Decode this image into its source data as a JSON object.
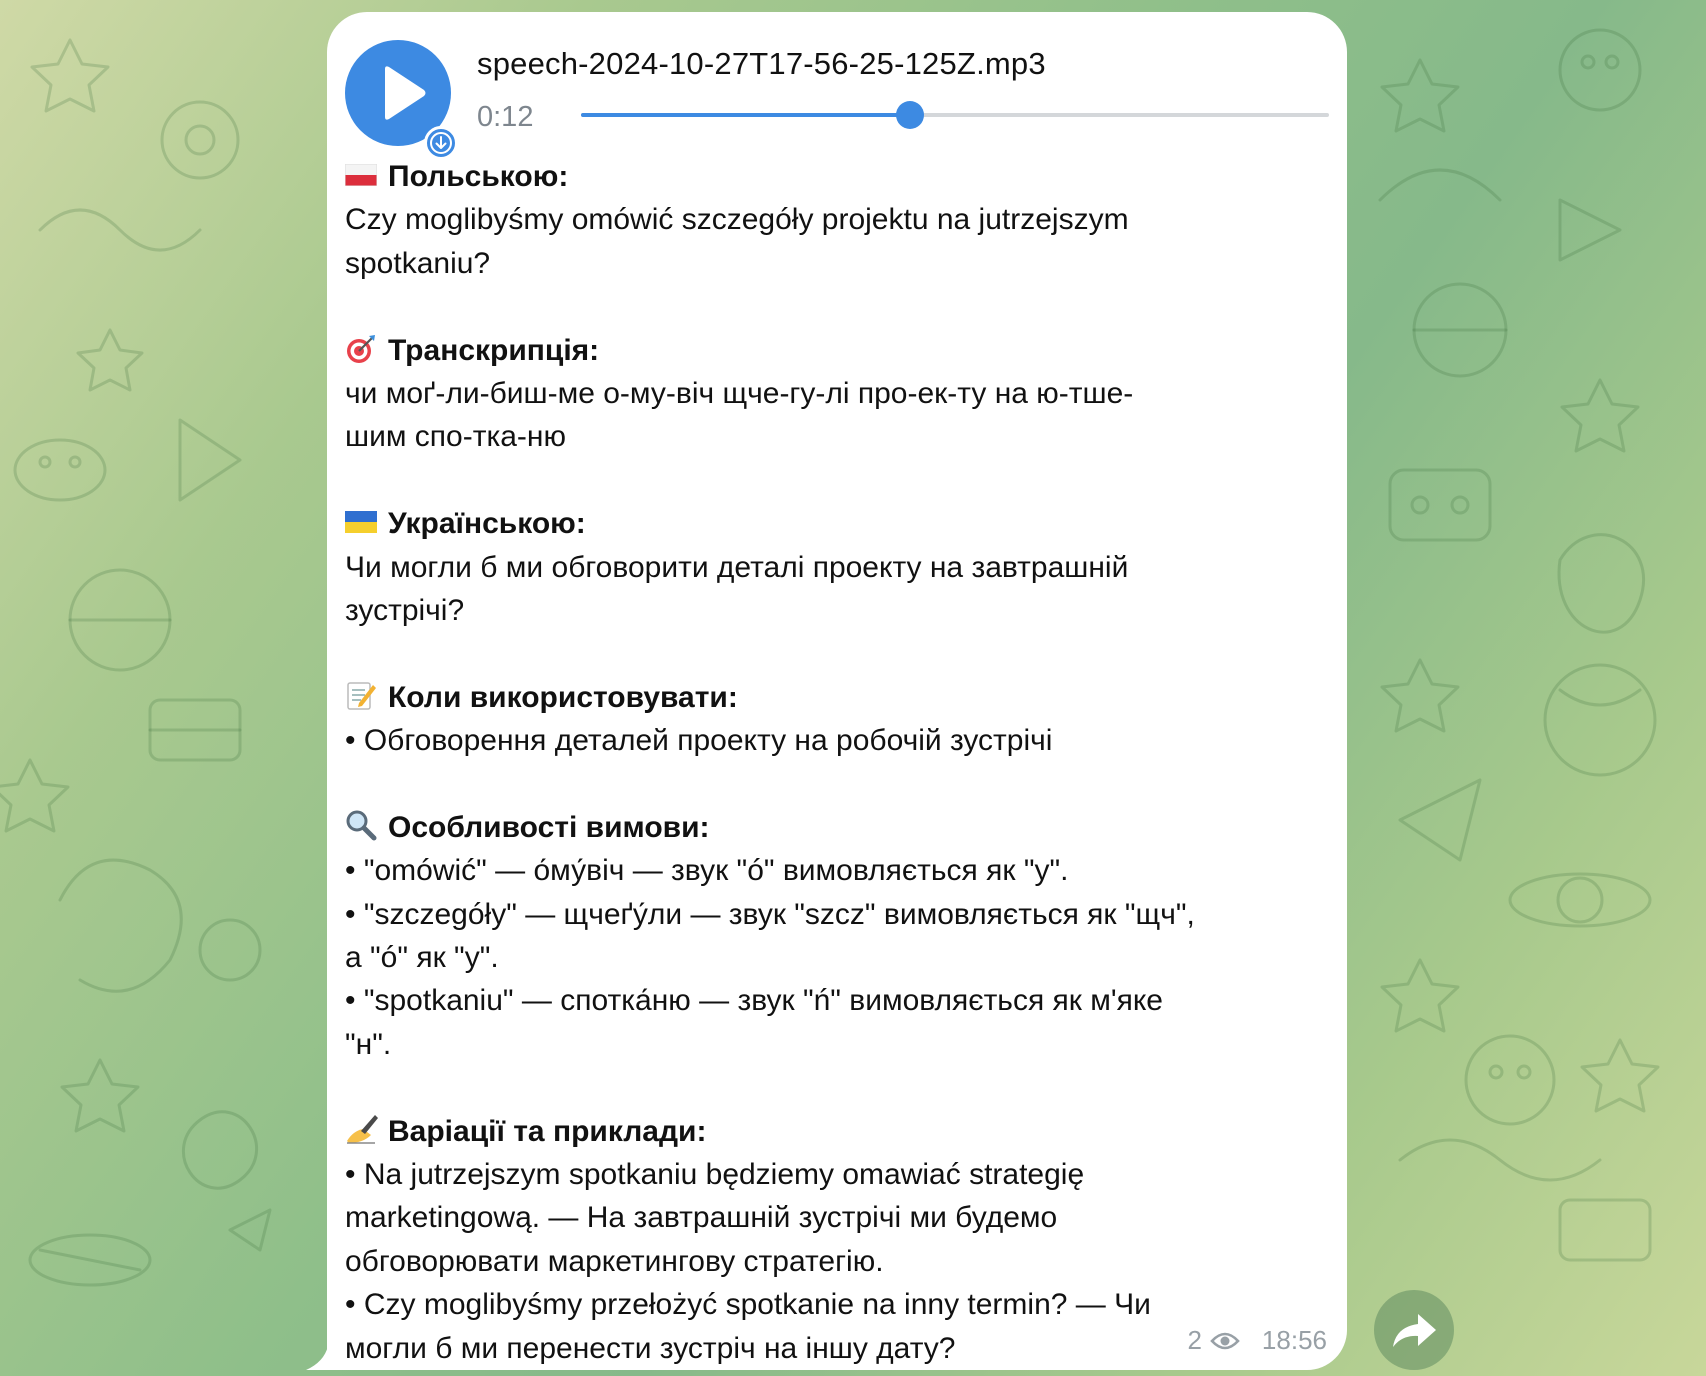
{
  "audio": {
    "file_name": "speech-2024-10-27T17-56-25-125Z.mp3",
    "duration": "0:12",
    "progress_fraction": 0.44,
    "accent_color": "#3d8ae2"
  },
  "message": {
    "lines": [
      {
        "kind": "head",
        "emoji": "flag-poland-icon",
        "text": "Польською:"
      },
      {
        "kind": "text",
        "text": "Czy moglibyśmy omówić szczegóły projektu na jutrzejszym"
      },
      {
        "kind": "text",
        "text": "spotkaniu?"
      },
      {
        "kind": "blank",
        "text": ""
      },
      {
        "kind": "head",
        "emoji": "target-icon",
        "text": "Транскрипція:"
      },
      {
        "kind": "text",
        "text": "чи моґ-ли-биш-ме о-му-віч щче-гу-лі про-ек-ту на ю-тше-"
      },
      {
        "kind": "text",
        "text": "шим спо-тка-ню"
      },
      {
        "kind": "blank",
        "text": ""
      },
      {
        "kind": "head",
        "emoji": "flag-ukraine-icon",
        "text": "Українською:"
      },
      {
        "kind": "text",
        "text": "Чи могли б ми обговорити деталі проекту на завтрашній"
      },
      {
        "kind": "text",
        "text": "зустрічі?"
      },
      {
        "kind": "blank",
        "text": ""
      },
      {
        "kind": "head",
        "emoji": "memo-icon",
        "text": "Коли використовувати:"
      },
      {
        "kind": "text",
        "text": "• Обговорення деталей проекту на робочій зустрічі"
      },
      {
        "kind": "blank",
        "text": ""
      },
      {
        "kind": "head",
        "emoji": "magnifier-icon",
        "text": "Особливості вимови:"
      },
      {
        "kind": "text",
        "text": "• \"omówić\" — о́му́віч — звук \"ó\" вимовляється як \"у\"."
      },
      {
        "kind": "text",
        "text": "• \"szczegóły\" — щчеґу́ли — звук \"szcz\" вимовляється як \"щч\","
      },
      {
        "kind": "text",
        "text": "а \"ó\" як \"у\"."
      },
      {
        "kind": "text",
        "text": "• \"spotkaniu\" — спотка́ню — звук \"ń\" вимовляється як м'яке"
      },
      {
        "kind": "text",
        "text": "\"н\"."
      },
      {
        "kind": "blank",
        "text": ""
      },
      {
        "kind": "head",
        "emoji": "writing-hand-icon",
        "text": "Варіації та приклади:"
      },
      {
        "kind": "text",
        "text": "• Na jutrzejszym spotkaniu będziemy omawiać strategię"
      },
      {
        "kind": "text",
        "text": "marketingową. — На завтрашній зустрічі ми будемо"
      },
      {
        "kind": "text",
        "text": "обговорювати маркетингову стратегію."
      },
      {
        "kind": "text",
        "text": "• Czy moglibyśmy przełożyć spotkanie na inny termin? — Чи"
      },
      {
        "kind": "text",
        "text": "могли б ми перенести зустріч на іншу дату?"
      }
    ],
    "views": "2",
    "time": "18:56"
  }
}
